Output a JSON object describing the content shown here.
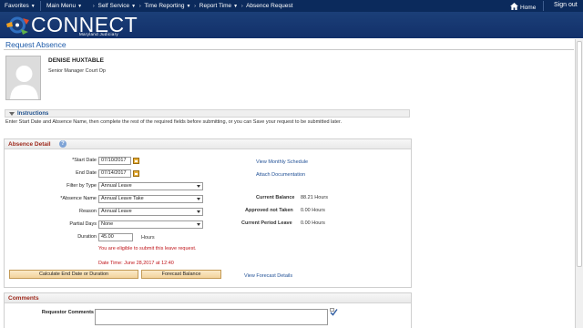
{
  "topnav": {
    "favorites": "Favorites",
    "main_menu": "Main Menu",
    "breadcrumbs": [
      "Self Service",
      "Time Reporting",
      "Report Time",
      "Absence Request"
    ],
    "home": "Home",
    "sign_out": "Sign out"
  },
  "logo": {
    "text": "CONNECT",
    "subtitle": "Maryland Judiciary"
  },
  "page": {
    "title": "Request Absence"
  },
  "employee": {
    "name": "DENISE HUXTABLE",
    "title": "Senior Manager Court Op"
  },
  "instructions": {
    "header": "Instructions",
    "text": "Enter Start Date and Absence Name, then complete the rest of the required fields before submitting, or you can Save your request to be submitted later."
  },
  "absence_detail": {
    "header": "Absence Detail",
    "start_date_label": "*Start Date",
    "start_date": "07/10/2017",
    "end_date_label": "End Date",
    "end_date": "07/14/2017",
    "filter_label": "Filter by Type",
    "filter_value": "Annual Leave",
    "absence_name_label": "*Absence Name",
    "absence_name_value": "Annual Leave Take",
    "reason_label": "Reason",
    "reason_value": "Annual Leave",
    "partial_days_label": "Partial Days",
    "partial_days_value": "None",
    "duration_label": "Duration",
    "duration_value": "45.00",
    "duration_unit": "Hours",
    "eligible_msg": "You are eligible to submit this leave request.",
    "datetime_msg": "Date Time: June 28,2017 at 12:40",
    "calc_button": "Calculate End Date or Duration",
    "forecast_button": "Forecast Balance",
    "view_monthly_link": "View Monthly Schedule",
    "attach_link": "Attach Documentation",
    "current_balance_label": "Current Balance",
    "current_balance_value": "88.21 Hours",
    "approved_label": "Approved not Taken",
    "approved_value": "0.00 Hours",
    "current_period_label": "Current Period Leave",
    "current_period_value": "0.00 Hours",
    "forecast_link": "View Forecast Details"
  },
  "comments": {
    "header": "Comments",
    "requestor_label": "Requestor Comments",
    "requestor_value": ""
  },
  "colors": {
    "nav": "#0b2a5c",
    "logo_bar": "#1b3f78",
    "section_title": "#9e2a1d",
    "link": "#1f4f95",
    "message": "#c0151a",
    "button": "#f3d39c"
  }
}
